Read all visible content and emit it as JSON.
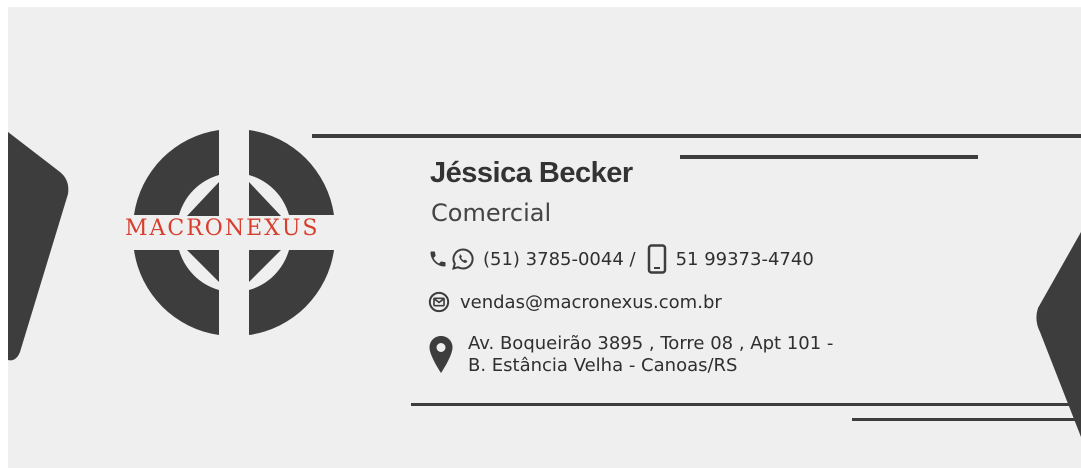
{
  "brand": {
    "name": "MACRONEXUS",
    "accent_color": "#d63e2e",
    "dark_color": "#3d3d3d"
  },
  "person": {
    "name": "Jéssica Becker",
    "role": "Comercial"
  },
  "contact": {
    "phones": "(51) 3785-0044 /",
    "mobile": "51 99373-4740",
    "email": "vendas@macronexus.com.br",
    "address_line1": "Av. Boqueirão 3895 , Torre 08 , Apt 101 -",
    "address_line2": "B. Estância Velha - Canoas/RS"
  },
  "icons": [
    "phone-icon",
    "whatsapp-icon",
    "mobile-phone-icon",
    "email-icon",
    "location-pin-icon"
  ]
}
